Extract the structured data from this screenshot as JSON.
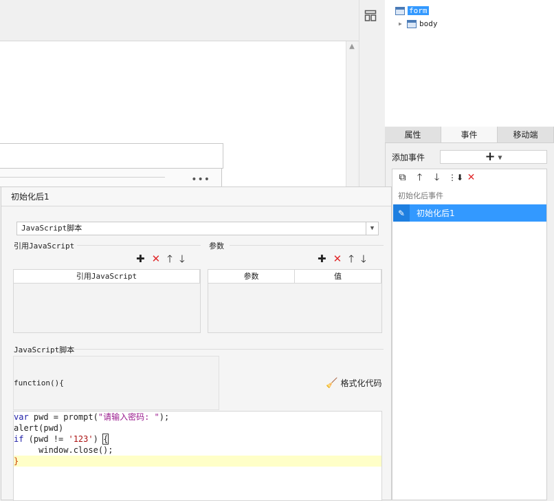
{
  "tree": {
    "items": [
      {
        "label": "form",
        "selected": true
      },
      {
        "label": "body",
        "selected": false
      }
    ]
  },
  "tabs": [
    "属性",
    "事件",
    "移动端"
  ],
  "active_tab": "事件",
  "events_panel": {
    "add_label": "添加事件",
    "add_button": "+",
    "group_label": "初始化后事件",
    "items": [
      "初始化后1"
    ]
  },
  "dialog": {
    "title": "初始化后1",
    "type_select": "JavaScript脚本",
    "ref_js_section": "引用JavaScript",
    "params_section": "参数",
    "ref_js_column": "引用JavaScript",
    "params_columns": [
      "参数",
      "值"
    ],
    "script_section": "JavaScript脚本",
    "function_header": "function(){",
    "format_button": "格式化代码"
  },
  "code_lines": [
    "var pwd = prompt(\"请输入密码: \");",
    "alert(pwd)",
    "if (pwd != '123') {",
    "     window.close();",
    "}"
  ],
  "colors": {
    "selection": "#3399ff",
    "delete": "#e0282a"
  }
}
